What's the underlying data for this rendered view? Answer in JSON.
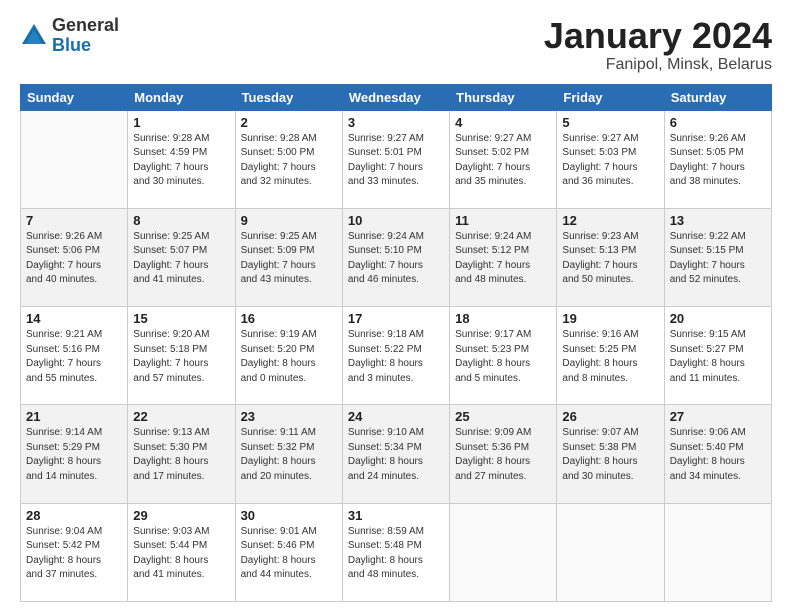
{
  "header": {
    "logo_general": "General",
    "logo_blue": "Blue",
    "title": "January 2024",
    "subtitle": "Fanipol, Minsk, Belarus"
  },
  "days_of_week": [
    "Sunday",
    "Monday",
    "Tuesday",
    "Wednesday",
    "Thursday",
    "Friday",
    "Saturday"
  ],
  "weeks": [
    [
      {
        "num": "",
        "info": ""
      },
      {
        "num": "1",
        "info": "Sunrise: 9:28 AM\nSunset: 4:59 PM\nDaylight: 7 hours\nand 30 minutes."
      },
      {
        "num": "2",
        "info": "Sunrise: 9:28 AM\nSunset: 5:00 PM\nDaylight: 7 hours\nand 32 minutes."
      },
      {
        "num": "3",
        "info": "Sunrise: 9:27 AM\nSunset: 5:01 PM\nDaylight: 7 hours\nand 33 minutes."
      },
      {
        "num": "4",
        "info": "Sunrise: 9:27 AM\nSunset: 5:02 PM\nDaylight: 7 hours\nand 35 minutes."
      },
      {
        "num": "5",
        "info": "Sunrise: 9:27 AM\nSunset: 5:03 PM\nDaylight: 7 hours\nand 36 minutes."
      },
      {
        "num": "6",
        "info": "Sunrise: 9:26 AM\nSunset: 5:05 PM\nDaylight: 7 hours\nand 38 minutes."
      }
    ],
    [
      {
        "num": "7",
        "info": "Sunrise: 9:26 AM\nSunset: 5:06 PM\nDaylight: 7 hours\nand 40 minutes."
      },
      {
        "num": "8",
        "info": "Sunrise: 9:25 AM\nSunset: 5:07 PM\nDaylight: 7 hours\nand 41 minutes."
      },
      {
        "num": "9",
        "info": "Sunrise: 9:25 AM\nSunset: 5:09 PM\nDaylight: 7 hours\nand 43 minutes."
      },
      {
        "num": "10",
        "info": "Sunrise: 9:24 AM\nSunset: 5:10 PM\nDaylight: 7 hours\nand 46 minutes."
      },
      {
        "num": "11",
        "info": "Sunrise: 9:24 AM\nSunset: 5:12 PM\nDaylight: 7 hours\nand 48 minutes."
      },
      {
        "num": "12",
        "info": "Sunrise: 9:23 AM\nSunset: 5:13 PM\nDaylight: 7 hours\nand 50 minutes."
      },
      {
        "num": "13",
        "info": "Sunrise: 9:22 AM\nSunset: 5:15 PM\nDaylight: 7 hours\nand 52 minutes."
      }
    ],
    [
      {
        "num": "14",
        "info": "Sunrise: 9:21 AM\nSunset: 5:16 PM\nDaylight: 7 hours\nand 55 minutes."
      },
      {
        "num": "15",
        "info": "Sunrise: 9:20 AM\nSunset: 5:18 PM\nDaylight: 7 hours\nand 57 minutes."
      },
      {
        "num": "16",
        "info": "Sunrise: 9:19 AM\nSunset: 5:20 PM\nDaylight: 8 hours\nand 0 minutes."
      },
      {
        "num": "17",
        "info": "Sunrise: 9:18 AM\nSunset: 5:22 PM\nDaylight: 8 hours\nand 3 minutes."
      },
      {
        "num": "18",
        "info": "Sunrise: 9:17 AM\nSunset: 5:23 PM\nDaylight: 8 hours\nand 5 minutes."
      },
      {
        "num": "19",
        "info": "Sunrise: 9:16 AM\nSunset: 5:25 PM\nDaylight: 8 hours\nand 8 minutes."
      },
      {
        "num": "20",
        "info": "Sunrise: 9:15 AM\nSunset: 5:27 PM\nDaylight: 8 hours\nand 11 minutes."
      }
    ],
    [
      {
        "num": "21",
        "info": "Sunrise: 9:14 AM\nSunset: 5:29 PM\nDaylight: 8 hours\nand 14 minutes."
      },
      {
        "num": "22",
        "info": "Sunrise: 9:13 AM\nSunset: 5:30 PM\nDaylight: 8 hours\nand 17 minutes."
      },
      {
        "num": "23",
        "info": "Sunrise: 9:11 AM\nSunset: 5:32 PM\nDaylight: 8 hours\nand 20 minutes."
      },
      {
        "num": "24",
        "info": "Sunrise: 9:10 AM\nSunset: 5:34 PM\nDaylight: 8 hours\nand 24 minutes."
      },
      {
        "num": "25",
        "info": "Sunrise: 9:09 AM\nSunset: 5:36 PM\nDaylight: 8 hours\nand 27 minutes."
      },
      {
        "num": "26",
        "info": "Sunrise: 9:07 AM\nSunset: 5:38 PM\nDaylight: 8 hours\nand 30 minutes."
      },
      {
        "num": "27",
        "info": "Sunrise: 9:06 AM\nSunset: 5:40 PM\nDaylight: 8 hours\nand 34 minutes."
      }
    ],
    [
      {
        "num": "28",
        "info": "Sunrise: 9:04 AM\nSunset: 5:42 PM\nDaylight: 8 hours\nand 37 minutes."
      },
      {
        "num": "29",
        "info": "Sunrise: 9:03 AM\nSunset: 5:44 PM\nDaylight: 8 hours\nand 41 minutes."
      },
      {
        "num": "30",
        "info": "Sunrise: 9:01 AM\nSunset: 5:46 PM\nDaylight: 8 hours\nand 44 minutes."
      },
      {
        "num": "31",
        "info": "Sunrise: 8:59 AM\nSunset: 5:48 PM\nDaylight: 8 hours\nand 48 minutes."
      },
      {
        "num": "",
        "info": ""
      },
      {
        "num": "",
        "info": ""
      },
      {
        "num": "",
        "info": ""
      }
    ]
  ]
}
